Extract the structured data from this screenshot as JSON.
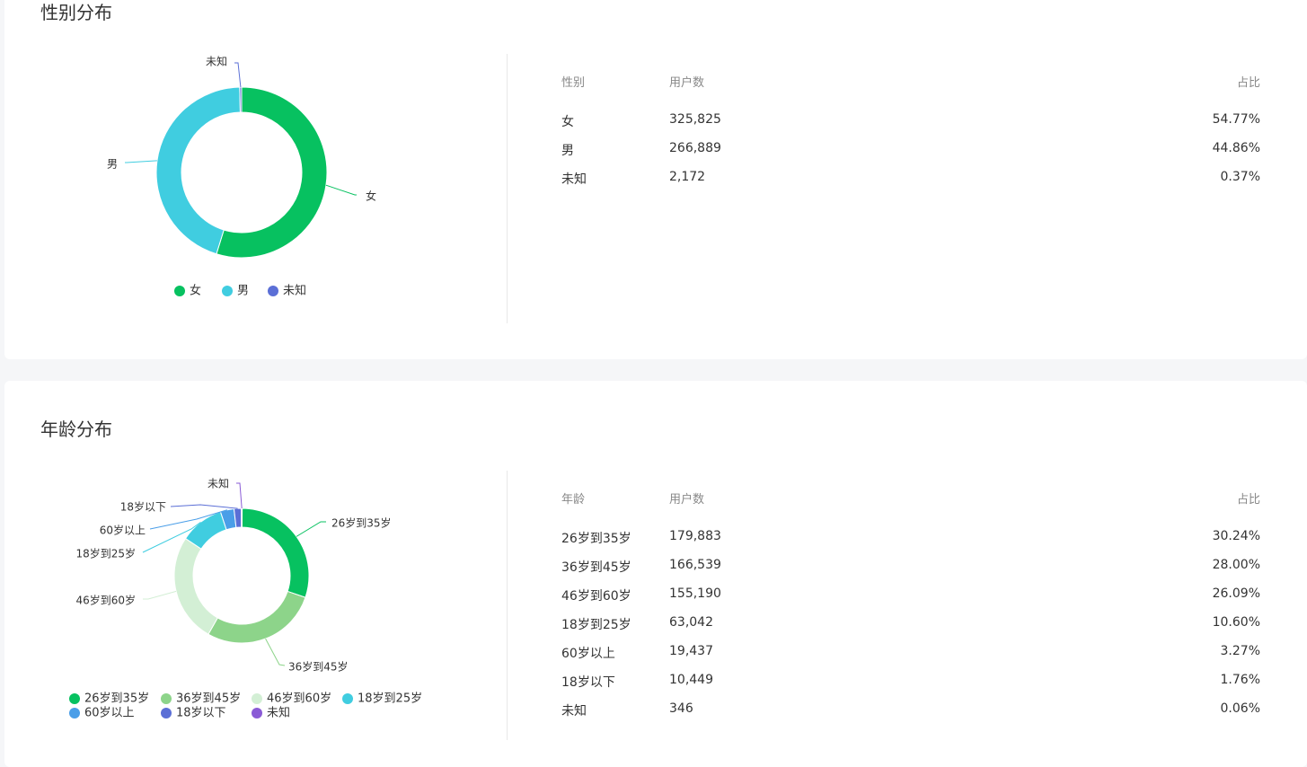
{
  "gender": {
    "title": "性别分布",
    "table": {
      "headers": [
        "性别",
        "用户数",
        "占比"
      ],
      "rows": [
        {
          "name": "女",
          "count": "325,825",
          "pct": "54.77%"
        },
        {
          "name": "男",
          "count": "266,889",
          "pct": "44.86%"
        },
        {
          "name": "未知",
          "count": "2,172",
          "pct": "0.37%"
        }
      ]
    }
  },
  "age": {
    "title": "年龄分布",
    "table": {
      "headers": [
        "年龄",
        "用户数",
        "占比"
      ],
      "rows": [
        {
          "name": "26岁到35岁",
          "count": "179,883",
          "pct": "30.24%"
        },
        {
          "name": "36岁到45岁",
          "count": "166,539",
          "pct": "28.00%"
        },
        {
          "name": "46岁到60岁",
          "count": "155,190",
          "pct": "26.09%"
        },
        {
          "name": "18岁到25岁",
          "count": "63,042",
          "pct": "10.60%"
        },
        {
          "name": "60岁以上",
          "count": "19,437",
          "pct": "3.27%"
        },
        {
          "name": "18岁以下",
          "count": "10,449",
          "pct": "1.76%"
        },
        {
          "name": "未知",
          "count": "346",
          "pct": "0.06%"
        }
      ]
    }
  },
  "chart_data": [
    {
      "type": "pie",
      "categories": [
        "女",
        "男",
        "未知"
      ],
      "values": [
        325825,
        266889,
        2172
      ],
      "colors": [
        "#07c160",
        "#40cde0",
        "#5b6fd6"
      ],
      "legend": "bottom"
    },
    {
      "type": "pie",
      "categories": [
        "26岁到35岁",
        "36岁到45岁",
        "46岁到60岁",
        "18岁到25岁",
        "60岁以上",
        "18岁以下",
        "未知"
      ],
      "values": [
        179883,
        166539,
        155190,
        63042,
        19437,
        10449,
        346
      ],
      "colors": [
        "#07c160",
        "#8dd48a",
        "#d3efd5",
        "#40cde0",
        "#4a9ee8",
        "#5b6fd6",
        "#8a5bd6"
      ],
      "legend": "bottom"
    }
  ]
}
